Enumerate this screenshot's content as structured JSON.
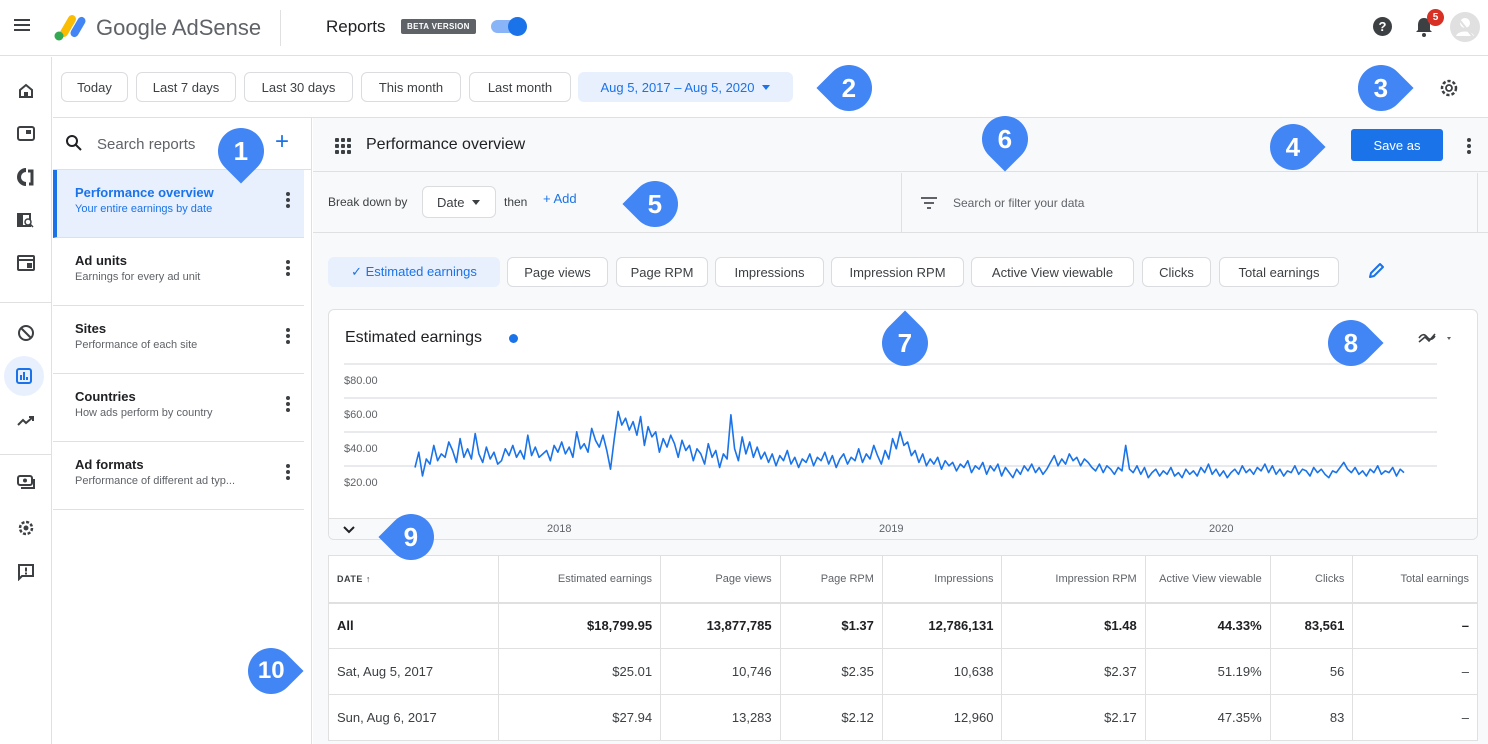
{
  "topbar": {
    "brand": "Google AdSense",
    "section": "Reports",
    "beta_badge": "BETA VERSION",
    "beta_toggle_on": true,
    "help_icon": "?",
    "notification_count": "5"
  },
  "leftnav": {
    "items": [
      {
        "name": "home",
        "icon": "home-icon"
      },
      {
        "name": "ads",
        "icon": "ads-icon"
      },
      {
        "name": "auto-ads",
        "icon": "auto-ads-icon"
      },
      {
        "name": "sites",
        "icon": "site-search-icon"
      },
      {
        "name": "ad-units",
        "icon": "ad-unit-icon"
      },
      {
        "name": "blocking",
        "icon": "block-icon"
      },
      {
        "name": "reports",
        "icon": "bar-chart-icon",
        "active": true
      },
      {
        "name": "optimization",
        "icon": "trending-icon"
      },
      {
        "name": "payments",
        "icon": "payments-icon"
      },
      {
        "name": "account",
        "icon": "settings-icon"
      },
      {
        "name": "feedback",
        "icon": "feedback-icon"
      }
    ]
  },
  "datebar": {
    "presets": [
      "Today",
      "Last 7 days",
      "Last 30 days",
      "This month",
      "Last month"
    ],
    "selected_range": "Aug 5, 2017 – Aug 5, 2020"
  },
  "reports": {
    "search_placeholder": "Search reports",
    "add_label": "+",
    "items": [
      {
        "title": "Performance overview",
        "subtitle": "Your entire earnings by date",
        "active": true
      },
      {
        "title": "Ad units",
        "subtitle": "Earnings for every ad unit"
      },
      {
        "title": "Sites",
        "subtitle": "Performance of each site"
      },
      {
        "title": "Countries",
        "subtitle": "How ads perform by country"
      },
      {
        "title": "Ad formats",
        "subtitle": "Performance of different ad typ..."
      }
    ]
  },
  "main": {
    "title": "Performance overview",
    "save_label": "Save as",
    "breakdown_label": "Break down by",
    "breakdown_value": "Date",
    "then_label": "then",
    "add_label": "+  Add",
    "filter_placeholder": "Search or filter your data",
    "metrics": [
      {
        "label": "✓  Estimated earnings",
        "selected": true
      },
      {
        "label": "Page views"
      },
      {
        "label": "Page RPM"
      },
      {
        "label": "Impressions"
      },
      {
        "label": "Impression RPM"
      },
      {
        "label": "Active View viewable"
      },
      {
        "label": "Clicks"
      },
      {
        "label": "Total earnings"
      }
    ]
  },
  "chart_data": {
    "type": "line",
    "title": "Estimated earnings",
    "series_color": "#1a73e8",
    "ylim": [
      0,
      80
    ],
    "yticks": [
      "$80.00",
      "$60.00",
      "$40.00",
      "$20.00"
    ],
    "ytick_values": [
      80,
      60,
      40,
      20
    ],
    "xticks": [
      "2018",
      "2019",
      "2020"
    ],
    "x_range": [
      "Aug 5, 2017",
      "Aug 5, 2020"
    ],
    "series": [
      {
        "name": "Estimated earnings",
        "values": [
          25,
          34,
          20,
          30,
          27,
          38,
          29,
          33,
          31,
          40,
          35,
          28,
          42,
          31,
          36,
          30,
          45,
          33,
          28,
          37,
          30,
          34,
          27,
          29,
          36,
          32,
          38,
          31,
          35,
          30,
          44,
          32,
          37,
          31,
          33,
          35,
          29,
          38,
          34,
          40,
          33,
          37,
          31,
          46,
          36,
          39,
          34,
          48,
          41,
          37,
          44,
          35,
          24,
          42,
          58,
          50,
          54,
          47,
          52,
          44,
          55,
          38,
          49,
          43,
          46,
          34,
          42,
          37,
          44,
          39,
          31,
          41,
          35,
          38,
          29,
          36,
          33,
          27,
          39,
          31,
          35,
          25,
          33,
          30,
          56,
          36,
          29,
          43,
          33,
          40,
          31,
          37,
          30,
          34,
          28,
          33,
          26,
          32,
          29,
          35,
          27,
          31,
          25,
          30,
          28,
          33,
          26,
          31,
          29,
          34,
          27,
          32,
          25,
          30,
          33,
          27,
          31,
          29,
          36,
          28,
          33,
          30,
          38,
          32,
          27,
          35,
          30,
          42,
          36,
          46,
          38,
          40,
          32,
          35,
          28,
          33,
          26,
          30,
          27,
          31,
          24,
          29,
          26,
          28,
          23,
          27,
          25,
          29,
          22,
          26,
          24,
          28,
          21,
          26,
          23,
          27,
          20,
          25,
          22,
          19,
          24,
          21,
          26,
          23,
          27,
          22,
          25,
          21,
          24,
          28,
          32,
          26,
          30,
          27,
          33,
          29,
          31,
          26,
          30,
          28,
          25,
          23,
          27,
          22,
          26,
          24,
          21,
          25,
          23,
          38,
          24,
          22,
          26,
          21,
          25,
          19,
          22,
          24,
          20,
          23,
          21,
          25,
          20,
          22,
          19,
          24,
          21,
          23,
          20,
          25,
          22,
          27,
          21,
          24,
          20,
          23,
          19,
          22,
          24,
          21,
          26,
          22,
          24,
          21,
          25,
          23,
          27,
          22,
          26,
          21,
          24,
          20,
          23,
          22,
          26,
          21,
          24,
          23,
          20,
          25,
          22,
          24,
          21,
          19,
          23,
          22,
          25,
          28,
          24,
          22,
          25,
          21,
          23,
          20,
          24,
          22,
          26,
          21,
          23,
          22,
          25,
          20,
          24,
          22
        ]
      }
    ]
  },
  "table": {
    "columns": [
      "DATE  ↑",
      "Estimated earnings",
      "Page views",
      "Page RPM",
      "Impressions",
      "Impression RPM",
      "Active View viewable",
      "Clicks",
      "Total earnings"
    ],
    "rows": [
      {
        "cells": [
          "All",
          "$18,799.95",
          "13,877,785",
          "$1.37",
          "12,786,131",
          "$1.48",
          "44.33%",
          "83,561",
          "–"
        ],
        "total": true
      },
      {
        "cells": [
          "Sat, Aug 5, 2017",
          "$25.01",
          "10,746",
          "$2.35",
          "10,638",
          "$2.37",
          "51.19%",
          "56",
          "–"
        ]
      },
      {
        "cells": [
          "Sun, Aug 6, 2017",
          "$27.94",
          "13,283",
          "$2.12",
          "12,960",
          "$2.17",
          "47.35%",
          "83",
          "–"
        ]
      }
    ]
  },
  "callouts": [
    "1",
    "2",
    "3",
    "4",
    "5",
    "6",
    "7",
    "8",
    "9",
    "10"
  ],
  "colors": {
    "accent": "#1a73e8",
    "callout": "#4285f4",
    "badge": "#d93025"
  }
}
